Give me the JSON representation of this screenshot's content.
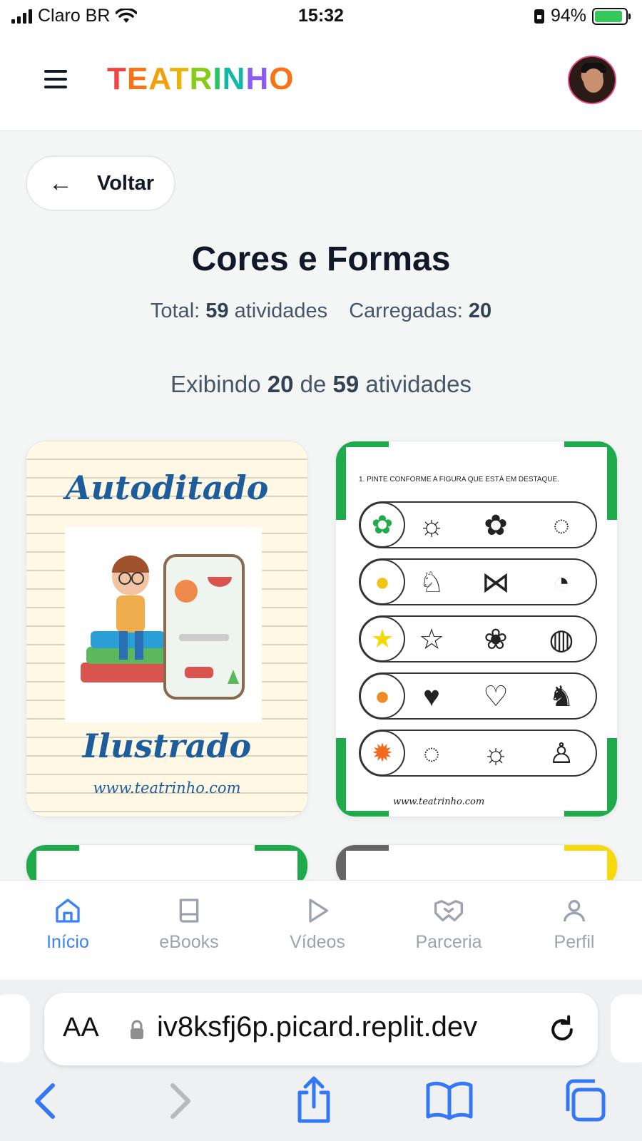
{
  "status_bar": {
    "carrier": "Claro BR",
    "time": "15:32",
    "battery": "94%"
  },
  "header": {
    "logo_letters": [
      {
        "ch": "T",
        "color": "#ef4444"
      },
      {
        "ch": "E",
        "color": "#f97316"
      },
      {
        "ch": "A",
        "color": "#f59e0b"
      },
      {
        "ch": "T",
        "color": "#eab308"
      },
      {
        "ch": "R",
        "color": "#84cc16"
      },
      {
        "ch": "I",
        "color": "#22c55e"
      },
      {
        "ch": "N",
        "color": "#14b8a6"
      },
      {
        "ch": "H",
        "color": "#8b5cf6"
      },
      {
        "ch": "O",
        "color": "#f97316"
      }
    ]
  },
  "back_button": {
    "label": "Voltar"
  },
  "page": {
    "title": "Cores e Formas",
    "total_label": "Total:",
    "total_value": "59",
    "total_suffix": "atividades",
    "loaded_label": "Carregadas:",
    "loaded_value": "20",
    "showing_prefix": "Exibindo",
    "showing_count": "20",
    "showing_of": "de",
    "showing_total": "59",
    "showing_suffix": "atividades"
  },
  "cards": {
    "card1": {
      "title_top": "Autoditado",
      "title_bottom": "Ilustrado",
      "url": "www.teatrinho.com"
    },
    "card2": {
      "instruction": "1. PINTE CONFORME A FIGURA QUE ESTÁ EM DESTAQUE.",
      "url": "www.teatrinho.com"
    }
  },
  "bottom_nav": [
    {
      "label": "Início",
      "icon": "home-icon",
      "active": true
    },
    {
      "label": "eBooks",
      "icon": "book-icon",
      "active": false
    },
    {
      "label": "Vídeos",
      "icon": "play-icon",
      "active": false
    },
    {
      "label": "Parceria",
      "icon": "handshake-icon",
      "active": false
    },
    {
      "label": "Perfil",
      "icon": "user-icon",
      "active": false
    }
  ],
  "browser": {
    "text_size_label": "AA",
    "url": "iv8ksfj6p.picard.replit.dev"
  },
  "colors": {
    "accent": "#3b82f6",
    "sheet_green": "#1faa4b"
  }
}
